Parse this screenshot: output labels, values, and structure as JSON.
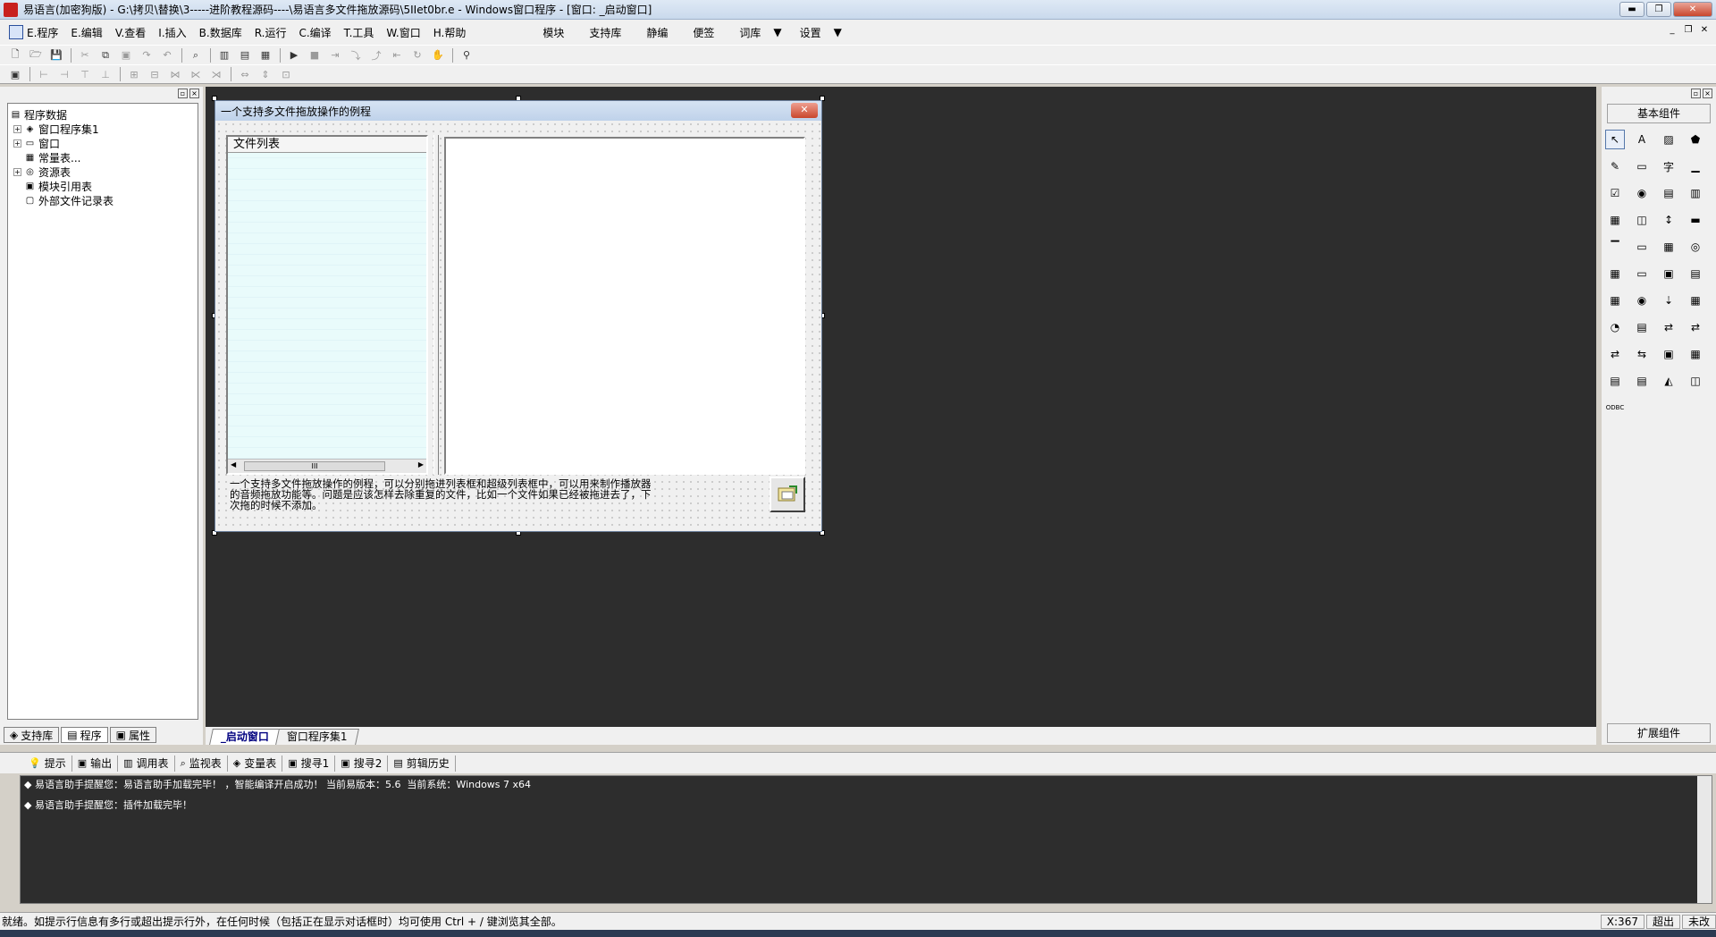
{
  "window": {
    "title": "易语言(加密狗版) - G:\\拷贝\\替换\\3-----进阶教程源码----\\易语言多文件拖放源码\\5IIet0br.e - Windows窗口程序 - [窗口: _启动窗口]",
    "min": "▬",
    "max": "❐",
    "close": "✕"
  },
  "menu": {
    "items": [
      "E.程序",
      "E.编辑",
      "V.查看",
      "I.插入",
      "B.数据库",
      "R.运行",
      "C.编译",
      "T.工具",
      "W.窗口",
      "H.帮助"
    ],
    "extra": [
      "模块",
      "支持库",
      "静编",
      "便签",
      "词库",
      "设置"
    ],
    "dropdown_arrow": "▼",
    "mdi": [
      "_",
      "❐",
      "✕"
    ]
  },
  "left_panel": {
    "tree": [
      {
        "label": "程序数据",
        "icon": "▤",
        "expander": ""
      },
      {
        "label": "窗口程序集1",
        "icon": "◈",
        "expander": "+"
      },
      {
        "label": "窗口",
        "icon": "▭",
        "expander": "+"
      },
      {
        "label": "常量表...",
        "icon": "▦",
        "expander": ""
      },
      {
        "label": "资源表",
        "icon": "◎",
        "expander": "+"
      },
      {
        "label": "模块引用表",
        "icon": "▣",
        "expander": ""
      },
      {
        "label": "外部文件记录表",
        "icon": "▢",
        "expander": ""
      }
    ],
    "tabs": [
      "支持库",
      "程序",
      "属性"
    ]
  },
  "form": {
    "title": "一个支持多文件拖放操作的例程",
    "close": "✕",
    "list_header": "文件列表",
    "scroll_thumb": "III",
    "scroll_left": "◀",
    "scroll_right": "▶",
    "description": "一个支持多文件拖放操作的例程，可以分别拖进列表框和超级列表框中，可以用来制作播放器的音频拖放功能等。问题是应该怎样去除重复的文件，比如一个文件如果已经被拖进去了，下次拖的时候不添加。"
  },
  "design_tabs": [
    "_启动窗口",
    "窗口程序集1"
  ],
  "right_panel": {
    "title": "基本组件",
    "extension": "扩展组件",
    "palette": [
      "↖",
      "A",
      "▨",
      "⬟",
      "✎",
      "▭",
      "字",
      "▁",
      "☑",
      "◉",
      "▤",
      "▥",
      "▦",
      "◫",
      "↕",
      "▬",
      "▔",
      "▭",
      "▦",
      "◎",
      "▦",
      "▭",
      "▣",
      "▤",
      "▦",
      "◉",
      "⇣",
      "▦",
      "◔",
      "▤",
      "⇄",
      "⇄",
      "⇄",
      "⇆",
      "▣",
      "▦",
      "▤",
      "▤",
      "◭",
      "◫",
      "ODBC"
    ]
  },
  "output_tabs": [
    {
      "icon": "💡",
      "label": "提示"
    },
    {
      "icon": "▣",
      "label": "输出"
    },
    {
      "icon": "▥",
      "label": "调用表"
    },
    {
      "icon": "⌕",
      "label": "监视表"
    },
    {
      "icon": "◈",
      "label": "变量表"
    },
    {
      "icon": "▣",
      "label": "搜寻1"
    },
    {
      "icon": "▣",
      "label": "搜寻2"
    },
    {
      "icon": "▤",
      "label": "剪辑历史"
    }
  ],
  "output": {
    "lines": [
      "◆ 易语言助手提醒您：易语言助手加载完毕！ ，智能编译开启成功！ 当前易版本：5.6  当前系统：Windows 7 x64",
      "◆ 易语言助手提醒您：插件加载完毕！"
    ]
  },
  "status": {
    "text": "就绪。如提示行信息有多行或超出提示行外，在任何时候（包括正在显示对话框时）均可使用 Ctrl + / 键浏览其全部。",
    "coord": "X:367",
    "mode": "超出",
    "state": "未改"
  }
}
